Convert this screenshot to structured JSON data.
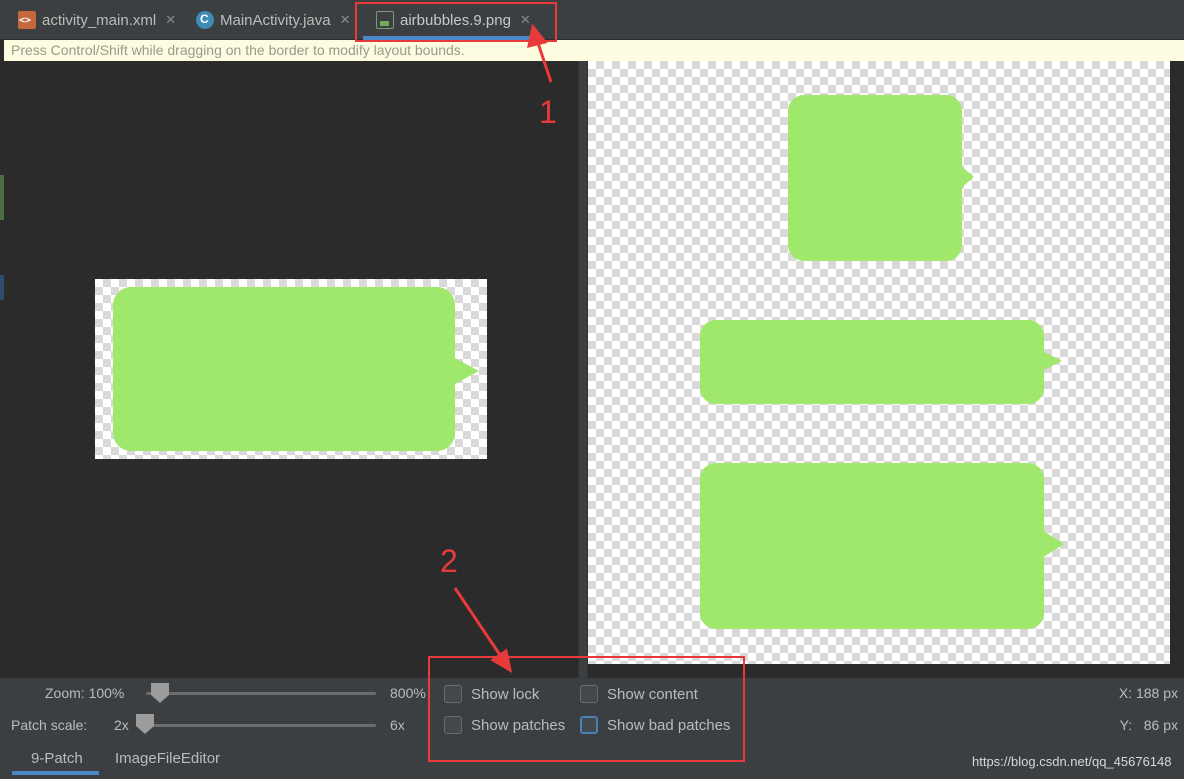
{
  "tabs": [
    {
      "label": "activity_main.xml",
      "icon": "xml-file-icon"
    },
    {
      "label": "MainActivity.java",
      "icon": "java-class-icon"
    },
    {
      "label": "airbubbles.9.png",
      "icon": "png-file-icon",
      "active": true
    }
  ],
  "hint": "Press Control/Shift while dragging on the border to modify layout bounds.",
  "controls": {
    "zoom_label": "Zoom: 100%",
    "zoom_max": "800%",
    "zoom_value_percent": 100,
    "patch_scale_label": "Patch scale:",
    "patch_scale_min": "2x",
    "patch_scale_max": "6x",
    "patch_scale_value": "2x",
    "checkboxes": {
      "show_lock": "Show lock",
      "show_content": "Show content",
      "show_patches": "Show patches",
      "show_bad_patches": "Show bad patches"
    },
    "coord_x": "X: 188 px",
    "coord_y": "Y:   86 px"
  },
  "bottom_tabs": [
    "9-Patch",
    "ImageFileEditor"
  ],
  "annotations": {
    "label_1": "1",
    "label_2": "2",
    "color": "#e83a3a"
  },
  "colors": {
    "bubble": "#a0e86b",
    "accent": "#4a88c7"
  },
  "watermark": "https://blog.csdn.net/qq_45676148"
}
